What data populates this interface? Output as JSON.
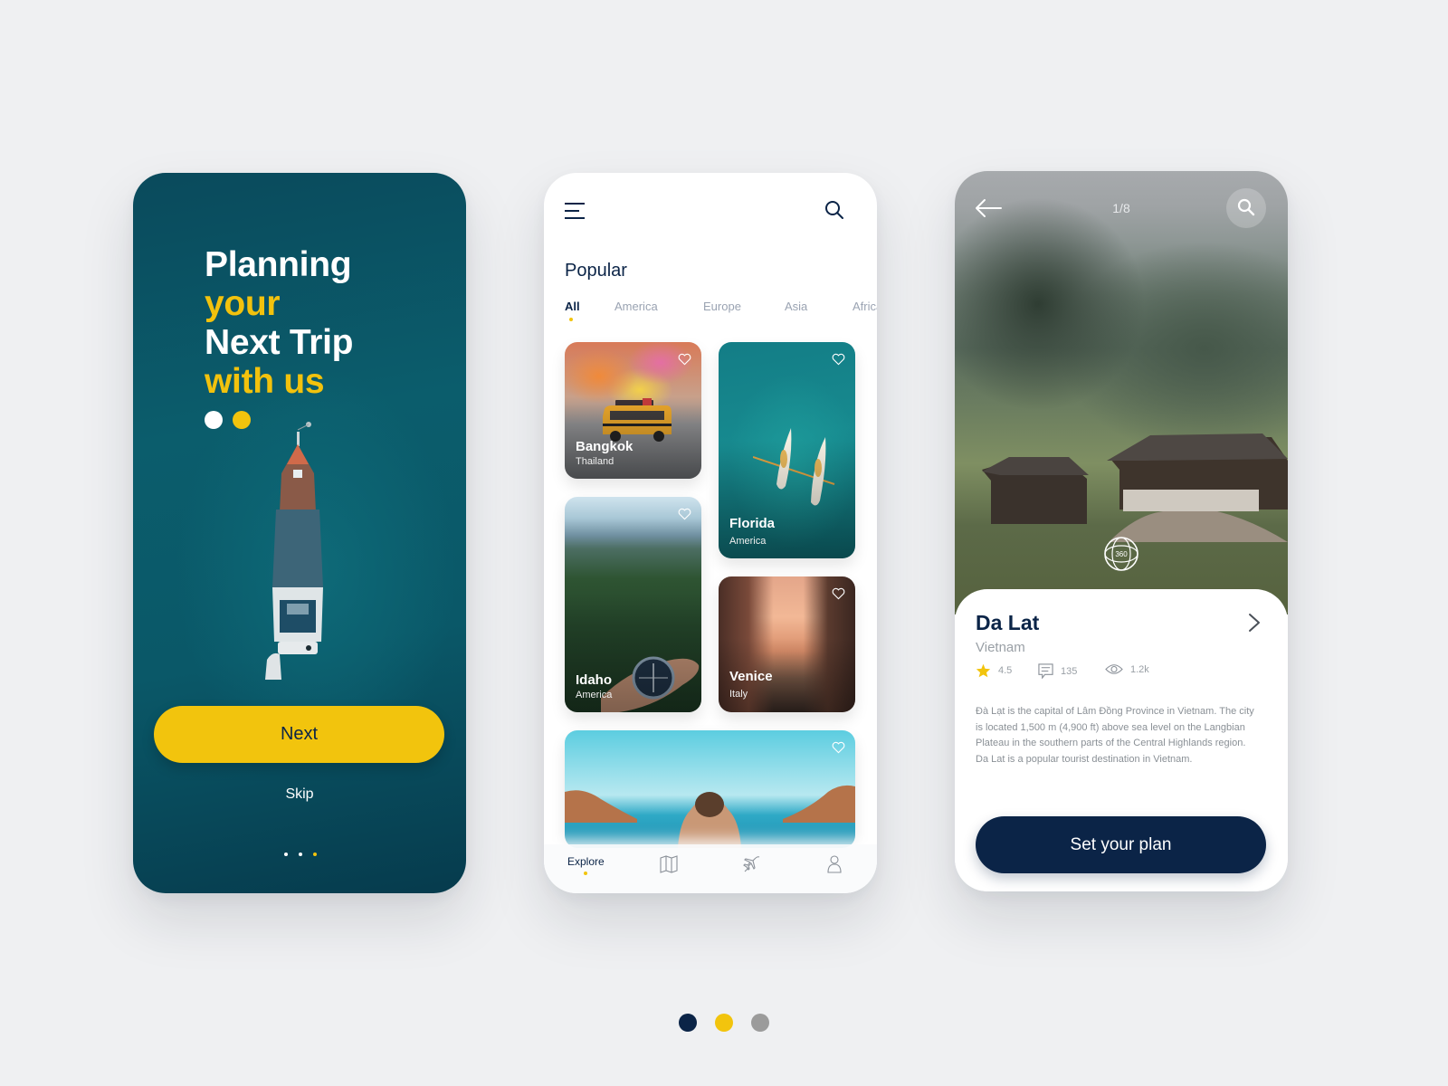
{
  "colors": {
    "accent_yellow": "#f2c40d",
    "navy": "#0b2447",
    "gray": "#9b9b9b",
    "background": "#eff0f2"
  },
  "onboarding": {
    "title_lines": [
      {
        "text": "Planning",
        "highlight": false
      },
      {
        "text": "your",
        "highlight": true
      },
      {
        "text": "Next Trip",
        "highlight": false
      },
      {
        "text": "with us",
        "highlight": true
      }
    ],
    "next_label": "Next",
    "skip_label": "Skip",
    "pager": {
      "total": 3,
      "active_index": 2
    }
  },
  "explore": {
    "section_title": "Popular",
    "tabs": [
      {
        "label": "All",
        "active": true
      },
      {
        "label": "America",
        "active": false
      },
      {
        "label": "Europe",
        "active": false
      },
      {
        "label": "Asia",
        "active": false
      },
      {
        "label": "Africa",
        "active": false
      }
    ],
    "cards": [
      {
        "name": "Bangkok",
        "country": "Thailand",
        "favorite": false
      },
      {
        "name": "Florida",
        "country": "America",
        "favorite": false
      },
      {
        "name": "Idaho",
        "country": "America",
        "favorite": false
      },
      {
        "name": "Venice",
        "country": "Italy",
        "favorite": false
      },
      {
        "name": "",
        "country": "",
        "favorite": false
      }
    ],
    "bottom_nav": [
      {
        "label": "Explore",
        "icon": "compass-label",
        "active": true
      },
      {
        "label": "",
        "icon": "map-icon",
        "active": false
      },
      {
        "label": "",
        "icon": "plane-icon",
        "active": false
      },
      {
        "label": "",
        "icon": "user-icon",
        "active": false
      }
    ]
  },
  "detail": {
    "counter": "1/8",
    "badge_360": "360",
    "name": "Da Lat",
    "country": "Vietnam",
    "rating": "4.5",
    "comments": "135",
    "views": "1.2k",
    "description": "Đà Lạt is the capital of Lâm Đồng Province in Vietnam. The city is located 1,500 m (4,900 ft) above sea level on the Langbian Plateau in the southern parts of the Central Highlands region. Da Lat is a popular tourist destination in Vietnam.",
    "cta_label": "Set your plan"
  },
  "page_indicator": {
    "dots": [
      "#0b2447",
      "#f2c40d",
      "#9b9b9b"
    ]
  }
}
